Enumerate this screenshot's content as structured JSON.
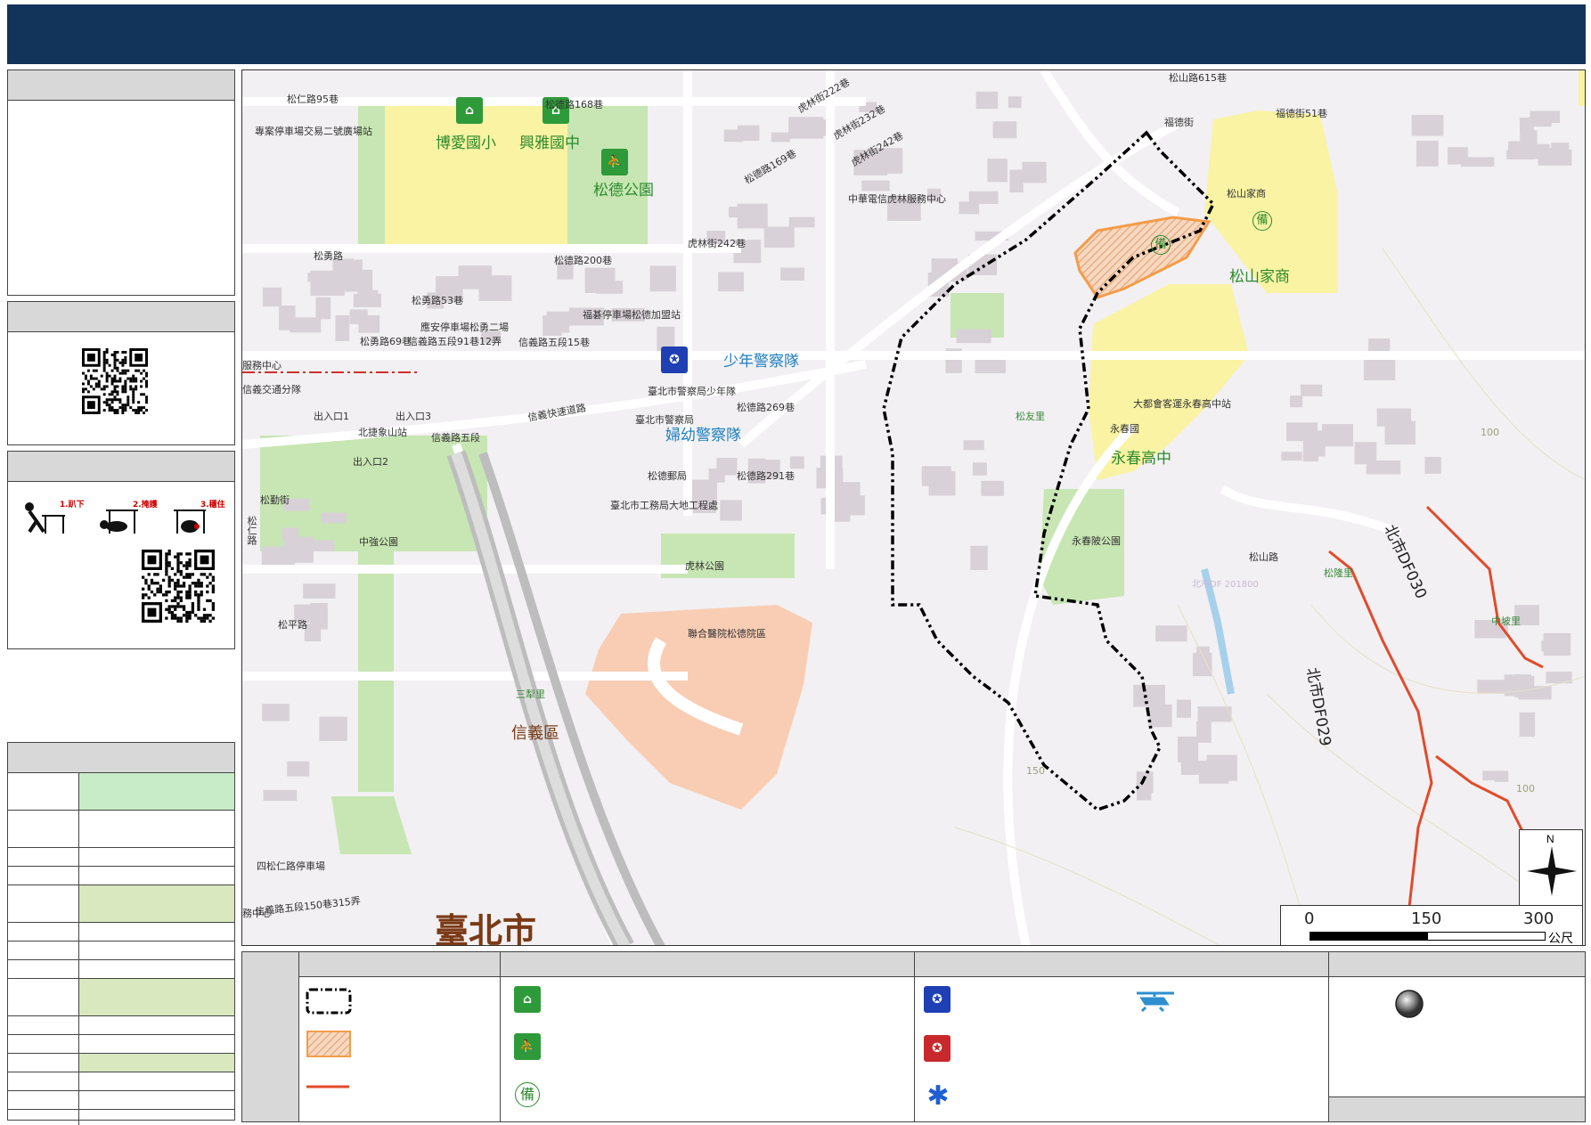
{
  "map": {
    "labels": {
      "school_boai": "博愛國小",
      "school_xingya": "興雅國中",
      "park_songde": "松德公園",
      "park_songde_short": "松",
      "songshan_home": "松山家商",
      "yongchun_high": "永春高中",
      "police_youth": "少年警察隊",
      "police_women": "婦幼警察隊",
      "district_xinyi": "信義區",
      "city_taipei": "臺北市",
      "village_sanli": "三犁里",
      "village_songyou": "松友里",
      "village_songlong": "松隆里",
      "village_zhongpo": "中坡里",
      "zhongqiang_park": "中強公園",
      "hulin_park": "虎林公園",
      "yongchun_park": "永春陂公園",
      "hospital": "聯合醫院松德院區",
      "police_hq": "臺北市警察局",
      "police_platoon": "臺北市警察局少年隊",
      "post_office": "松德郵局",
      "works_office": "臺北市工務局大地工程處",
      "hulin_service": "中華電信虎林服務中心",
      "bus_station": "大都會客運永春高中站",
      "songshan_home_small": "松山家商",
      "yongchun_small": "永春國",
      "exit1": "出入口1",
      "exit2": "出入口2",
      "exit3": "出入口3",
      "mrt_station": "北捷象山站",
      "parking1": "專案停車場交易二號廣場站",
      "parking2": "應安停車場松勇二場",
      "parking3": "福碁停車場松德加盟站",
      "parking4": "四松仁路停車場",
      "service_center": "服務中心",
      "service_center2": "務中心",
      "traffic": "信義交通分隊",
      "road_songren95": "松仁路95巷",
      "road_xingya168": "松德路168巷",
      "road_songyong": "松勇路",
      "road_songde200": "松德路200巷",
      "road_songyong53": "松勇路53巷",
      "road_songyong69": "松勇路69巷",
      "road_xinyi91_12": "信義路五段91巷12弄",
      "road_xinyi5_15": "信義路五段15巷",
      "road_xinyi5": "信義路五段",
      "road_xinyi_exp": "信義快速道路",
      "road_songde269": "松德路269巷",
      "road_songde291": "松德路291巷",
      "road_songde169": "松德路169巷",
      "road_hulin242": "虎林街242巷",
      "road_hulin222": "虎林街222巷",
      "road_hulin232": "虎林街232巷",
      "road_hulin242b": "虎林街242巷",
      "road_songshan": "松山路",
      "road_songshan615": "松山路615巷",
      "road_fude51": "福德街51巷",
      "road_fude": "福德街",
      "road_songqin": "松勤街",
      "road_songping": "松平路",
      "road_xinyi150_315": "信義路五段150巷315弄",
      "road_songren": "松仁路",
      "contour_100": "100",
      "contour_150": "150",
      "df029": "北市DF029",
      "df030": "北市DF030",
      "old_label": "北市DF 201800"
    },
    "colors": {
      "school_fill": "#f9f3a3",
      "park_fill": "#c7e6b3",
      "hospital_fill": "#f9cdb4",
      "boundary": "#000000",
      "debris_line": "#e24a2a",
      "landslide": "#f39c4a",
      "road": "#ffffff",
      "building": "#d6cfd6",
      "mrt_line": "#d0302c"
    },
    "scale": {
      "ticks": [
        "0",
        "150",
        "300"
      ],
      "unit": "公尺"
    },
    "compass": "N"
  },
  "legend": {
    "icons": [
      "boundary-dashed",
      "hatched-area",
      "red-line",
      "shelter-icon",
      "park-evacuation-icon",
      "reserve-icon",
      "police-icon",
      "fire-icon",
      "ambulance-icon",
      "helicopter-icon",
      "gray-circle-icon"
    ],
    "icon_reserve_glyph": "備"
  },
  "side": {
    "glyph_drop": "1.趴下",
    "glyph_cover": "2.掩護",
    "glyph_hold": "3.穩住"
  }
}
